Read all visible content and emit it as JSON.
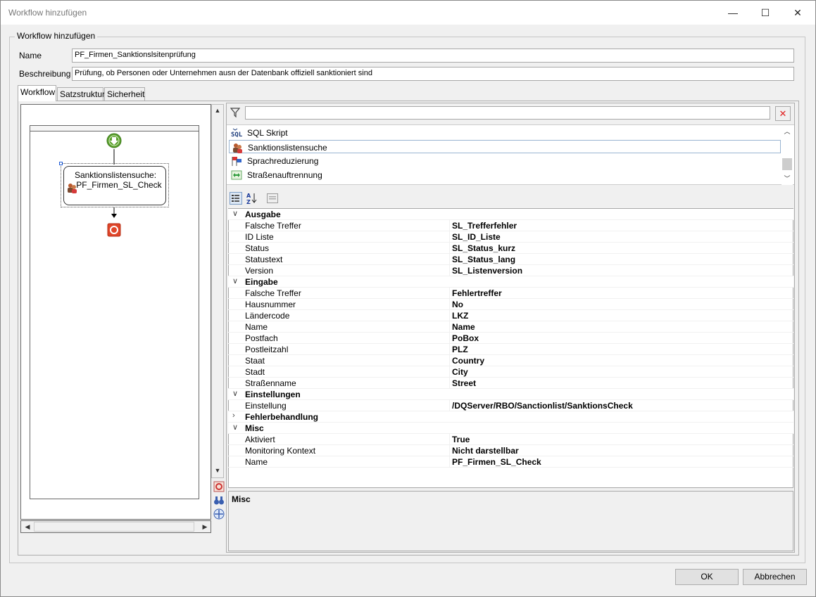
{
  "window": {
    "title": "Workflow hinzufügen",
    "minimize": "—",
    "maximize": "☐",
    "close": "✕"
  },
  "group_title": "Workflow hinzufügen",
  "form": {
    "name_label": "Name",
    "name_value": "PF_Firmen_Sanktionslsitenprüfung",
    "desc_label": "Beschreibung",
    "desc_value": "Prüfung, ob Personen oder Unternehmen ausn der Datenbank offiziell sanktioniert sind"
  },
  "tabs": [
    "Workflow",
    "Satzstruktur",
    "Sicherheit"
  ],
  "designer": {
    "node_line1": "Sanktionslistensuche:",
    "node_line2": "PF_Firmen_SL_Check"
  },
  "components": [
    {
      "label": "SQL Skript",
      "icon": "sql-icon"
    },
    {
      "label": "Sanktionslistensuche",
      "icon": "persons-icon"
    },
    {
      "label": "Sprachreduzierung",
      "icon": "flags-icon"
    },
    {
      "label": "Straßenauftrennung",
      "icon": "split-arrows-icon"
    }
  ],
  "properties": [
    {
      "category": "Ausgabe",
      "expanded": true,
      "rows": [
        {
          "k": "Falsche Treffer",
          "v": "SL_Trefferfehler"
        },
        {
          "k": "ID Liste",
          "v": "SL_ID_Liste"
        },
        {
          "k": "Status",
          "v": "SL_Status_kurz"
        },
        {
          "k": "Statustext",
          "v": "SL_Status_lang"
        },
        {
          "k": "Version",
          "v": "SL_Listenversion"
        }
      ]
    },
    {
      "category": "Eingabe",
      "expanded": true,
      "rows": [
        {
          "k": "Falsche Treffer",
          "v": "Fehlertreffer"
        },
        {
          "k": "Hausnummer",
          "v": "No"
        },
        {
          "k": "Ländercode",
          "v": "LKZ"
        },
        {
          "k": "Name",
          "v": "Name"
        },
        {
          "k": "Postfach",
          "v": "PoBox"
        },
        {
          "k": "Postleitzahl",
          "v": "PLZ"
        },
        {
          "k": "Staat",
          "v": "Country"
        },
        {
          "k": "Stadt",
          "v": "City"
        },
        {
          "k": "Straßenname",
          "v": "Street"
        }
      ]
    },
    {
      "category": "Einstellungen",
      "expanded": true,
      "rows": [
        {
          "k": "Einstellung",
          "v": "/DQServer/RBO/Sanctionlist/SanktionsCheck"
        }
      ]
    },
    {
      "category": "Fehlerbehandlung",
      "expanded": false,
      "rows": []
    },
    {
      "category": "Misc",
      "expanded": true,
      "rows": [
        {
          "k": "Aktiviert",
          "v": "True"
        },
        {
          "k": "Monitoring Kontext",
          "v": "Nicht darstellbar"
        },
        {
          "k": "Name",
          "v": "PF_Firmen_SL_Check"
        }
      ]
    }
  ],
  "description_panel_title": "Misc",
  "buttons": {
    "ok": "OK",
    "cancel": "Abbrechen"
  },
  "colors": {
    "start": "#5aa02c",
    "stop": "#e0462a",
    "selection": "#99b4d1"
  }
}
